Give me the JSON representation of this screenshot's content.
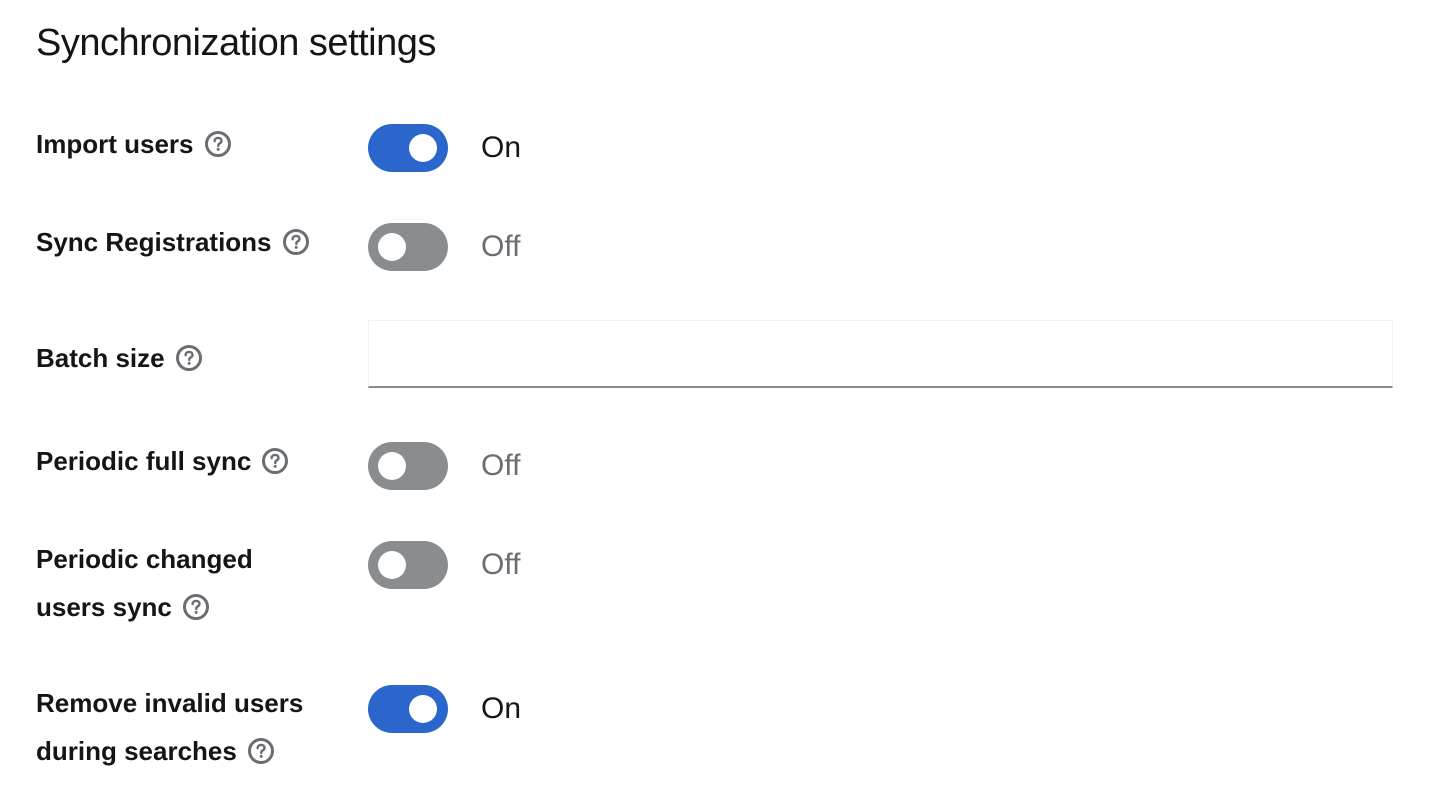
{
  "page": {
    "title": "Synchronization settings"
  },
  "fields": {
    "import_users": {
      "label": "Import users",
      "state": true,
      "state_text": "On"
    },
    "sync_registrations": {
      "label": "Sync Registrations",
      "state": false,
      "state_text": "Off"
    },
    "batch_size": {
      "label": "Batch size",
      "value": "",
      "placeholder": ""
    },
    "periodic_full_sync": {
      "label": "Periodic full sync",
      "state": false,
      "state_text": "Off"
    },
    "periodic_changed_users_sync": {
      "label_line1": "Periodic changed",
      "label_line2": "users sync",
      "state": false,
      "state_text": "Off"
    },
    "remove_invalid_users": {
      "label_line1": "Remove invalid users",
      "label_line2": "during searches",
      "state": true,
      "state_text": "On"
    }
  },
  "colors": {
    "switch_on": "#2b66cc",
    "switch_off": "#8a8d90",
    "help_icon": "#6a6e73",
    "text_primary": "#151515",
    "text_off": "#6a6e73"
  },
  "icons": {
    "help": "question-circle-icon"
  }
}
